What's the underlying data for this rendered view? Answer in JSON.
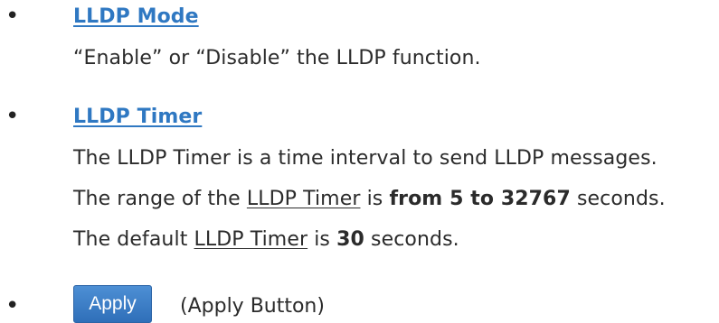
{
  "sections": {
    "lldp_mode": {
      "heading": "LLDP Mode",
      "description": "“Enable” or “Disable” the LLDP function."
    },
    "lldp_timer": {
      "heading": "LLDP Timer",
      "line1": "The LLDP Timer is a time interval to send LLDP messages.",
      "line2_prefix": "The range of the ",
      "line2_term": "LLDP Timer",
      "line2_mid": " is ",
      "line2_range": "from 5 to 32767",
      "line2_suffix": " seconds.",
      "line3_prefix": "The default ",
      "line3_term": "LLDP Timer",
      "line3_mid": " is ",
      "line3_value": "30",
      "line3_suffix": " seconds."
    },
    "apply": {
      "button_label": "Apply",
      "caption": "(Apply Button)"
    }
  },
  "colors": {
    "heading_link": "#2f78c2",
    "body_text": "#2b2b2b",
    "button_bg": "#3a7cc7",
    "button_text": "#ffffff"
  }
}
